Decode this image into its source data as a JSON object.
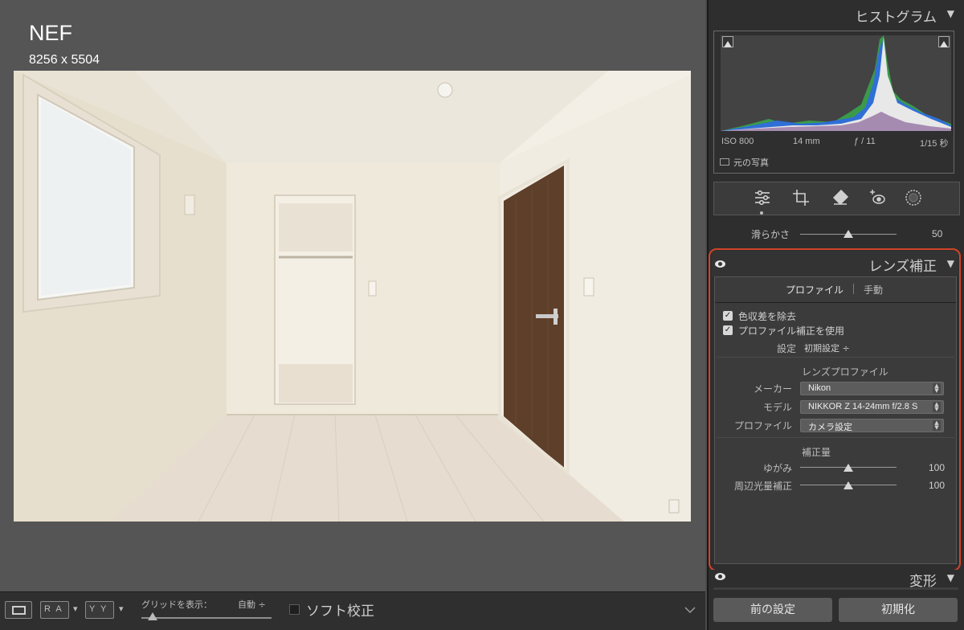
{
  "viewer": {
    "file_name": "NEF",
    "dimensions": "8256 x 5504"
  },
  "toolbar": {
    "view_mode_icons": [
      "single-view-icon",
      "before-after-lr-icon",
      "before-after-tb-icon"
    ],
    "ra_label": "R A",
    "yy_label": "Y Y",
    "grid_label": "グリッドを表示：",
    "grid_value": "自動 ÷",
    "soft_proof_label": "ソフト校正"
  },
  "panel": {
    "histogram": {
      "title": "ヒストグラム",
      "iso": "ISO 800",
      "focal": "14 mm",
      "aperture": "ƒ / 11",
      "shutter": "1/15 秒",
      "original_photo": "元の写真"
    },
    "tools": [
      "adjust-sliders-icon",
      "crop-icon",
      "eraser-icon",
      "red-eye-icon",
      "radial-mask-icon"
    ],
    "smoothness": {
      "label": "滑らかさ",
      "value": "50",
      "fraction": 0.5
    },
    "lens": {
      "title": "レンズ補正",
      "tab_profile": "プロファイル",
      "tab_manual": "手動",
      "remove_ca": "色収差を除去",
      "enable_profile": "プロファイル補正を使用",
      "setup_label": "設定",
      "setup_value": "初期設定 ÷",
      "lens_profile_heading": "レンズプロファイル",
      "make_label": "メーカー",
      "make_value": "Nikon",
      "model_label": "モデル",
      "model_value": "NIKKOR Z 14-24mm f/2.8 S",
      "profile_label": "プロファイル",
      "profile_value": "カメラ設定",
      "amount_heading": "補正量",
      "distortion_label": "ゆがみ",
      "distortion_value": "100",
      "vignetting_label": "周辺光量補正",
      "vignetting_value": "100"
    },
    "transform": {
      "title": "変形"
    },
    "buttons": {
      "previous": "前の設定",
      "reset": "初期化"
    }
  },
  "colors": {
    "highlight": "#d2432a",
    "panel_bg": "#2e2e2e",
    "viewer_bg": "#555555"
  }
}
